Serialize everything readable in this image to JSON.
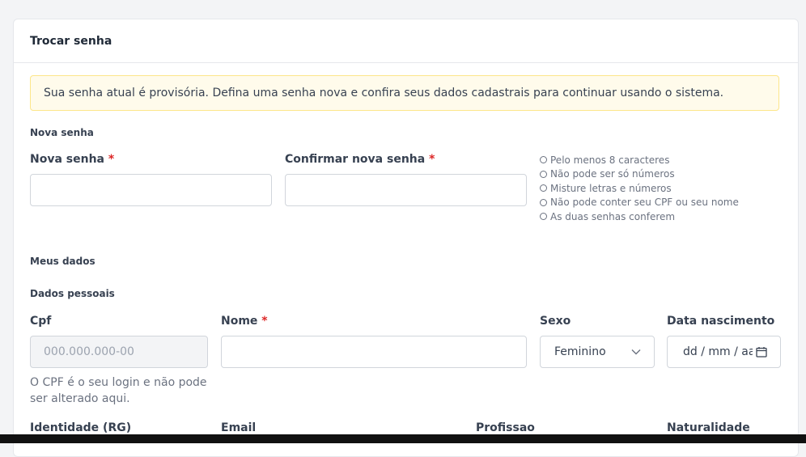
{
  "card": {
    "title": "Trocar senha"
  },
  "alert": {
    "text": "Sua senha atual é provisória. Defina uma senha nova e confira seus dados cadastrais para continuar usando o sistema."
  },
  "password_section": {
    "title": "Nova senha",
    "new_password_label": "Nova senha",
    "confirm_password_label": "Confirmar nova senha",
    "required_mark": "*",
    "rules": [
      "Pelo menos 8 caracteres",
      "Não pode ser só números",
      "Misture letras e números",
      "Não pode conter seu CPF ou seu nome",
      "As duas senhas conferem"
    ]
  },
  "my_data": {
    "title": "Meus dados",
    "personal_title": "Dados pessoais",
    "cpf_label": "Cpf",
    "cpf_placeholder": "000.000.000-00",
    "cpf_help": "O CPF é o seu login e não pode ser alterado aqui.",
    "name_label": "Nome",
    "sex_label": "Sexo",
    "sex_value": "Feminino",
    "birth_label": "Data nascimento",
    "birth_placeholder": "dd / mm / aaaa",
    "rg_label": "Identidade (RG)",
    "email_label": "Email",
    "profession_label": "Profissao",
    "naturality_label": "Naturalidade"
  }
}
